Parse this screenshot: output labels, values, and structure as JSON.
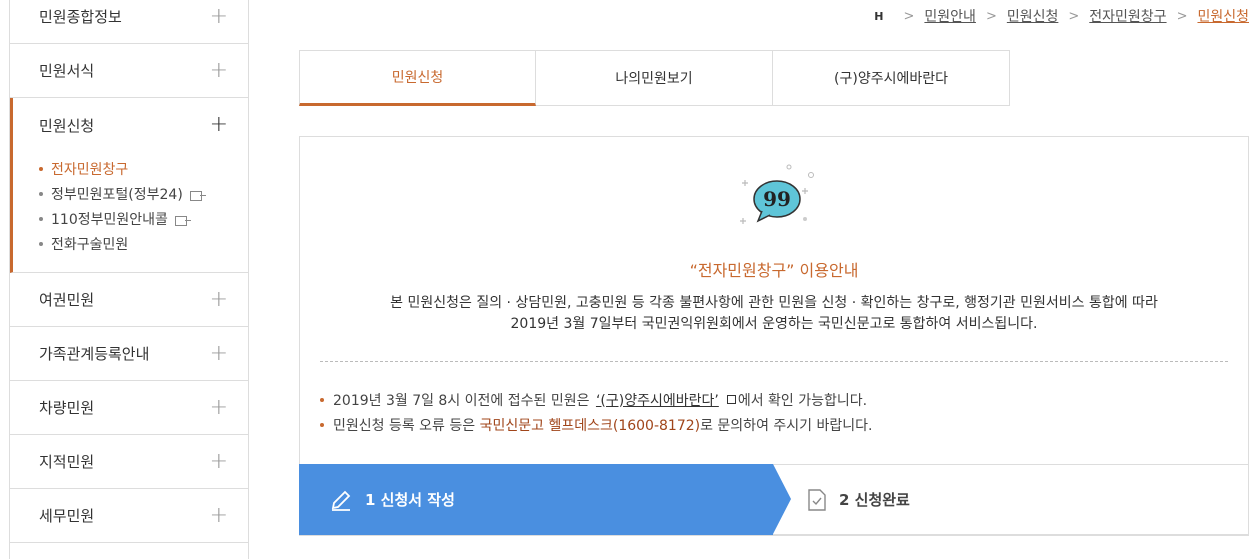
{
  "sidebar": {
    "items_top": [
      {
        "label": "민원종합정보"
      },
      {
        "label": "민원서식"
      }
    ],
    "active": {
      "label": "민원신청"
    },
    "sub": [
      {
        "label": "전자민원창구",
        "external": false
      },
      {
        "label": "정부민원포털(정부24)",
        "external": true
      },
      {
        "label": "110정부민원안내콜",
        "external": true
      },
      {
        "label": "전화구술민원",
        "external": false
      }
    ],
    "items_bottom": [
      {
        "label": "여권민원"
      },
      {
        "label": "가족관계등록안내"
      },
      {
        "label": "차량민원"
      },
      {
        "label": "지적민원"
      },
      {
        "label": "세무민원"
      }
    ],
    "plus": "+"
  },
  "breadcrumb": {
    "home": "H",
    "sep": ">",
    "items": [
      "민원안내",
      "민원신청",
      "전자민원창구",
      "민원신청"
    ]
  },
  "tabs": [
    "민원신청",
    "나의민원보기",
    "(구)양주시에바란다"
  ],
  "info": {
    "title": "“전자민원창구” 이용안내",
    "desc_line1": "본 민원신청은 질의 · 상담민원, 고충민원 등 각종 불편사항에 관한 민원을 신청 · 확인하는 창구로, 행정기관 민원서비스 통합에 따라",
    "desc_line2": "2019년 3월 7일부터 국민권익위원회에서 운영하는 국민신문고로 통합하여 서비스됩니다."
  },
  "notes": {
    "n1_pre": "2019년 3월 7일 8시 이전에 접수된 민원은",
    "n1_link": "‘(구)양주시에바란다’",
    "n1_post": "에서 확인 가능합니다.",
    "n2_pre": "민원신청 등록 오류 등은",
    "n2_hl": "국민신문고 헬프데스크(1600-8172)",
    "n2_post": "로 문의하여 주시기 바랍니다."
  },
  "steps": {
    "step1": "1 신청서 작성",
    "step2": "2 신청완료"
  },
  "colors": {
    "accent": "#c8692f",
    "step_active": "#4a8fe0"
  }
}
